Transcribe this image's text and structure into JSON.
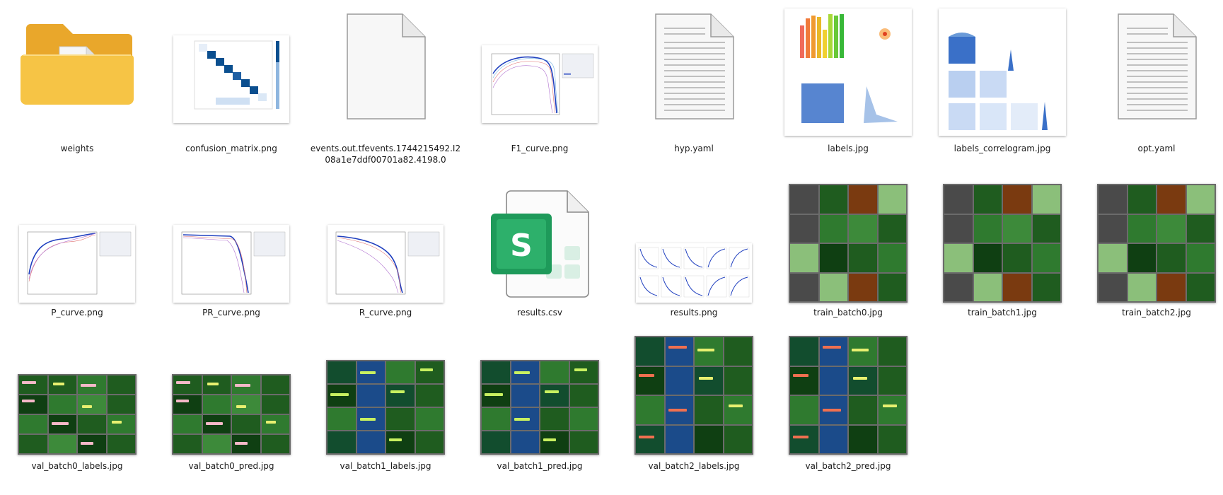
{
  "files": [
    {
      "name": "weights",
      "type": "folder"
    },
    {
      "name": "confusion_matrix.png",
      "type": "image"
    },
    {
      "name": "events.out.tfevents.1744215492.I208a1e7ddf00701a82.4198.0",
      "type": "file"
    },
    {
      "name": "F1_curve.png",
      "type": "image"
    },
    {
      "name": "hyp.yaml",
      "type": "text"
    },
    {
      "name": "labels.jpg",
      "type": "image"
    },
    {
      "name": "labels_correlogram.jpg",
      "type": "image"
    },
    {
      "name": "opt.yaml",
      "type": "text"
    },
    {
      "name": "P_curve.png",
      "type": "image"
    },
    {
      "name": "PR_curve.png",
      "type": "image"
    },
    {
      "name": "R_curve.png",
      "type": "image"
    },
    {
      "name": "results.csv",
      "type": "spreadsheet"
    },
    {
      "name": "results.png",
      "type": "image"
    },
    {
      "name": "train_batch0.jpg",
      "type": "image"
    },
    {
      "name": "train_batch1.jpg",
      "type": "image"
    },
    {
      "name": "train_batch2.jpg",
      "type": "image"
    },
    {
      "name": "val_batch0_labels.jpg",
      "type": "image"
    },
    {
      "name": "val_batch0_pred.jpg",
      "type": "image"
    },
    {
      "name": "val_batch1_labels.jpg",
      "type": "image"
    },
    {
      "name": "val_batch1_pred.jpg",
      "type": "image"
    },
    {
      "name": "val_batch2_labels.jpg",
      "type": "image"
    },
    {
      "name": "val_batch2_pred.jpg",
      "type": "image"
    }
  ],
  "icons": {
    "folder": "folder-icon",
    "file": "blank-file-icon",
    "text": "text-file-icon",
    "spreadsheet": "spreadsheet-icon",
    "spreadsheet_letter": "S"
  },
  "colors": {
    "folder": "#f6c445",
    "folder_dark": "#e9a72b",
    "spreadsheet_green": "#1e9a5a",
    "curve_blue": "#1f3fbf",
    "confusion_blue": "#0b4f8f",
    "pcb_green": "#1f5c1f"
  }
}
